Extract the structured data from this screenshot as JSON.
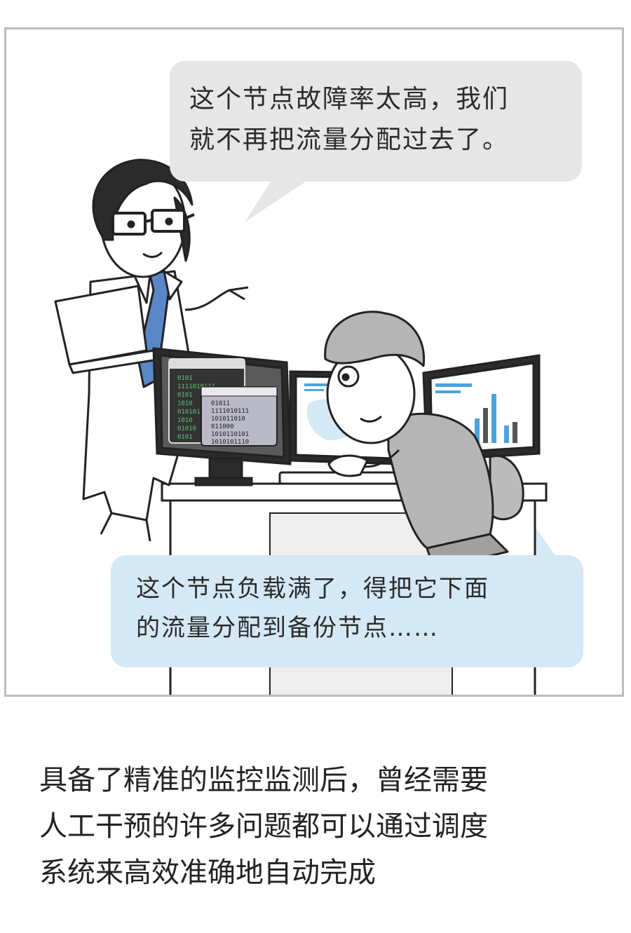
{
  "comic": {
    "speech_top": {
      "line1": "这个节点故障率太高，我们",
      "line2": "就不再把流量分配过去了。"
    },
    "speech_bottom": {
      "line1": "这个节点负载满了，得把它下面",
      "line2": "的流量分配到备份节点……"
    },
    "screen_left_back": [
      "0101",
      "1111010111",
      "0101",
      "1010",
      "010101",
      "1010",
      "01010",
      "0101"
    ],
    "screen_left_front": [
      "01011",
      "1111010111",
      "101011010",
      "011000",
      "1010110101",
      "1010101110"
    ],
    "colors": {
      "bubble_top": "#e6e6e6",
      "bubble_bottom": "#d4e8f6",
      "panel_border": "#bdbdbd",
      "tie": "#5b86c8",
      "binary_green": "#58c46a",
      "chart_blue": "#4aa3df"
    }
  },
  "caption": {
    "line1": "具备了精准的监控监测后，曾经需要",
    "line2": "人工干预的许多问题都可以通过调度",
    "line3": "系统来高效准确地自动完成"
  }
}
